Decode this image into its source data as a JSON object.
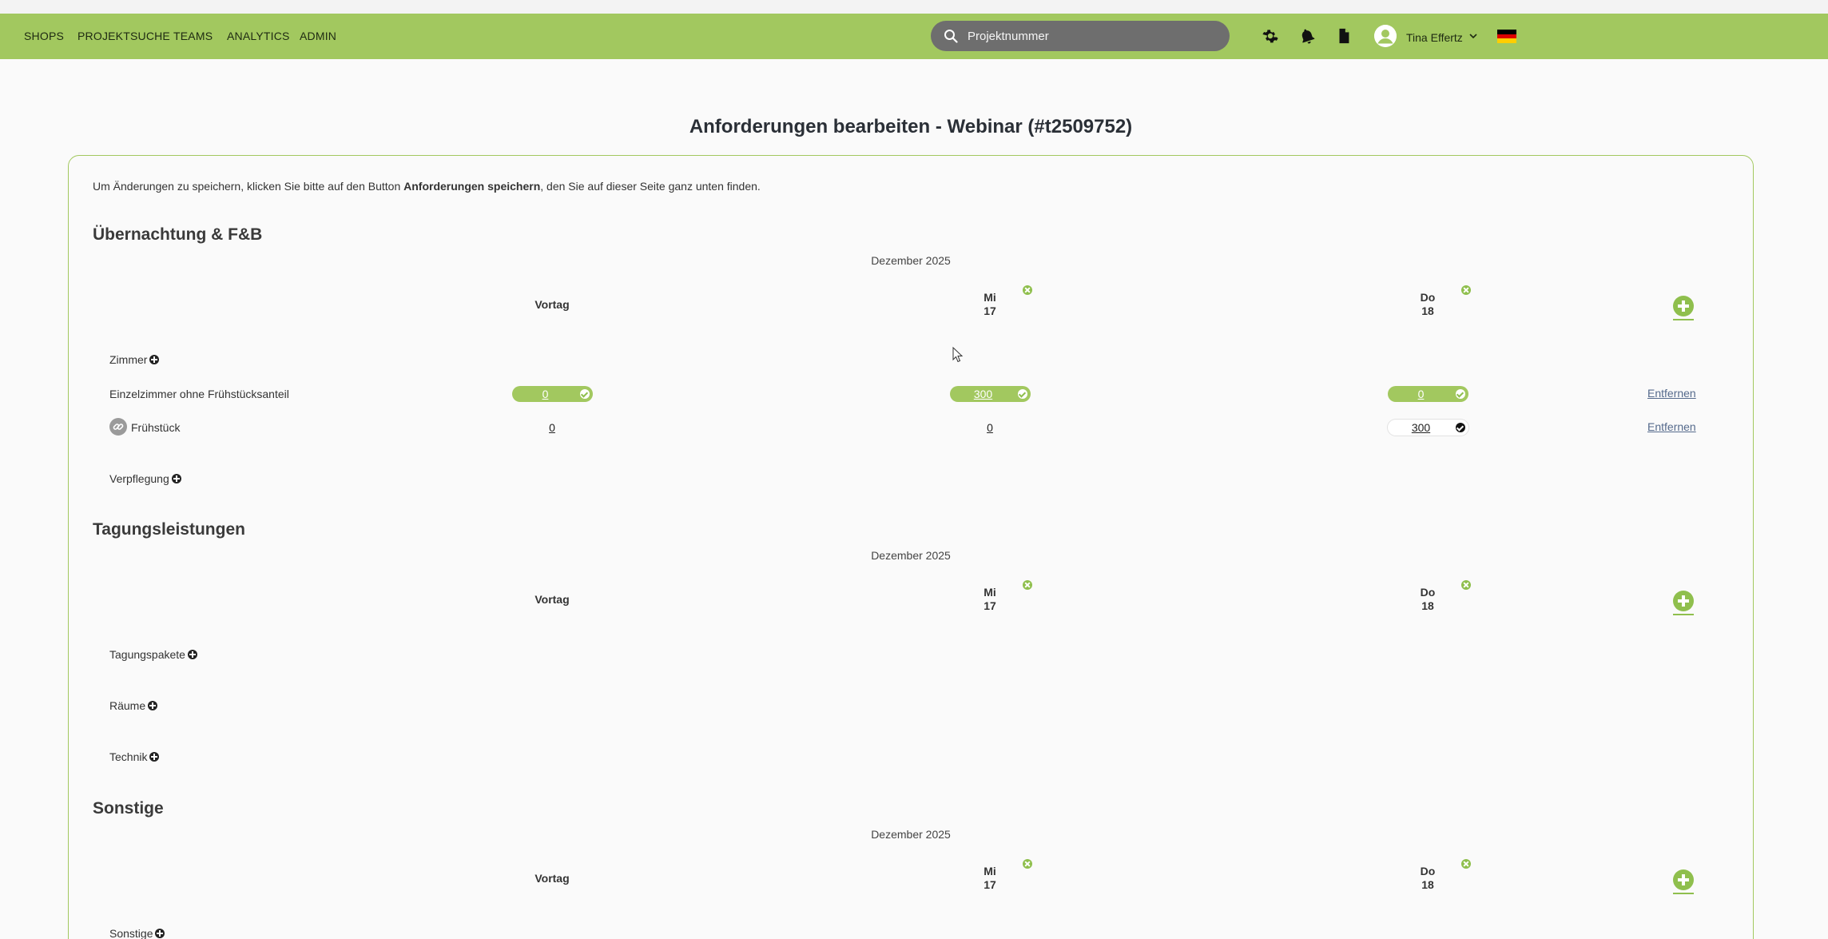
{
  "nav": {
    "items": [
      "SHOPS",
      "PROJEKTSUCHE",
      "TEAMS",
      "ANALYTICS",
      "ADMIN"
    ],
    "search_placeholder": "Projektnummer",
    "user_name": "Tina Effertz",
    "icons": [
      "gear-icon",
      "bell-icon",
      "document-icon",
      "user-icon",
      "flag-de-icon"
    ],
    "flag_colors": [
      "#000000",
      "#dd0000",
      "#ffce00"
    ]
  },
  "page": {
    "title": "Anforderungen bearbeiten - Webinar (#t2509752)",
    "intro_before": "Um Änderungen zu speichern, klicken Sie bitte auf den Button ",
    "intro_bold": "Anforderungen speichern",
    "intro_after": ", den Sie auf dieser Seite ganz unten finden."
  },
  "columns": {
    "month": "Dezember 2025",
    "vortag": "Vortag",
    "day1_weekday": "Mi",
    "day1_date": "17",
    "day2_weekday": "Do",
    "day2_date": "18"
  },
  "sections": {
    "uebernachtung": {
      "title": "Übernachtung & F&B",
      "zimmer_label": "Zimmer",
      "row1_label": "Einzelzimmer ohne Frühstücksanteil",
      "row1_values": [
        "0",
        "300",
        "0"
      ],
      "row2_label": "Frühstück",
      "row2_values": [
        "0",
        "0",
        "300"
      ],
      "remove_label": "Entfernen",
      "verpflegung_label": "Verpflegung"
    },
    "tagung": {
      "title": "Tagungsleistungen",
      "groups": [
        "Tagungspakete",
        "Räume",
        "Technik"
      ]
    },
    "sonstige": {
      "title": "Sonstige",
      "groups": [
        "Sonstige"
      ]
    }
  },
  "colors": {
    "accent": "#a2c85f",
    "accent_dark": "#8fbf4d",
    "link": "#556a8c"
  }
}
